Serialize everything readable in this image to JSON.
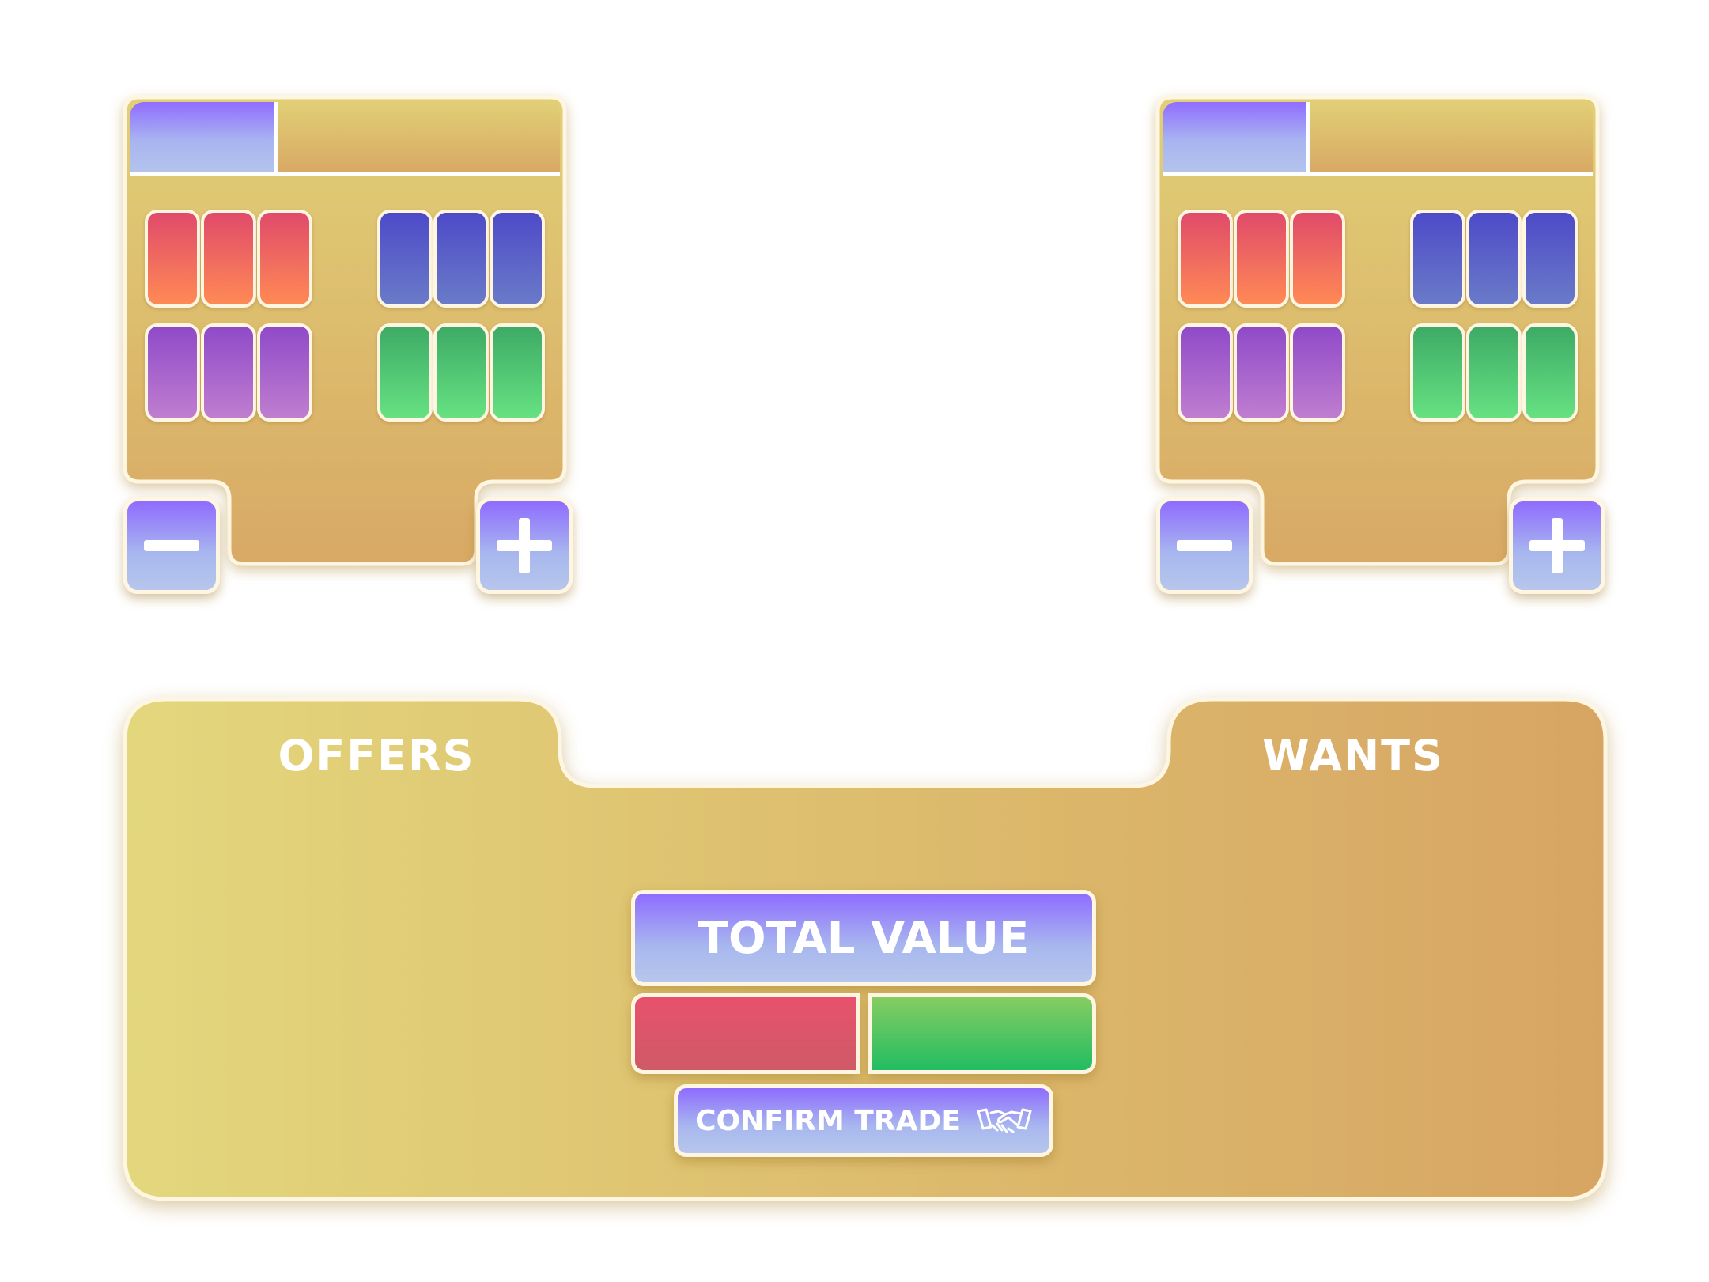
{
  "offers_panel": {
    "slot_rows": [
      [
        "red",
        "red",
        "red",
        "blue",
        "blue",
        "blue"
      ],
      [
        "purple",
        "purple",
        "purple",
        "green",
        "green",
        "green"
      ]
    ],
    "minus_icon": "minus-icon",
    "plus_icon": "plus-icon"
  },
  "wants_panel": {
    "slot_rows": [
      [
        "red",
        "red",
        "red",
        "blue",
        "blue",
        "blue"
      ],
      [
        "purple",
        "purple",
        "purple",
        "green",
        "green",
        "green"
      ]
    ],
    "minus_icon": "minus-icon",
    "plus_icon": "plus-icon"
  },
  "trade_board": {
    "offers_label": "OFFERS",
    "wants_label": "WANTS",
    "total_value_label": "TOTAL VALUE",
    "confirm_label": "CONFIRM TRADE",
    "confirm_icon": "handshake-icon"
  },
  "colors": {
    "panel_gold_top": "#e1cf76",
    "panel_gold_bottom": "#d8a965",
    "button_purple": "#8f6cff",
    "button_lavender": "#b6c6ec",
    "bar_red": "#e8516d",
    "bar_green": "#22bd62"
  }
}
